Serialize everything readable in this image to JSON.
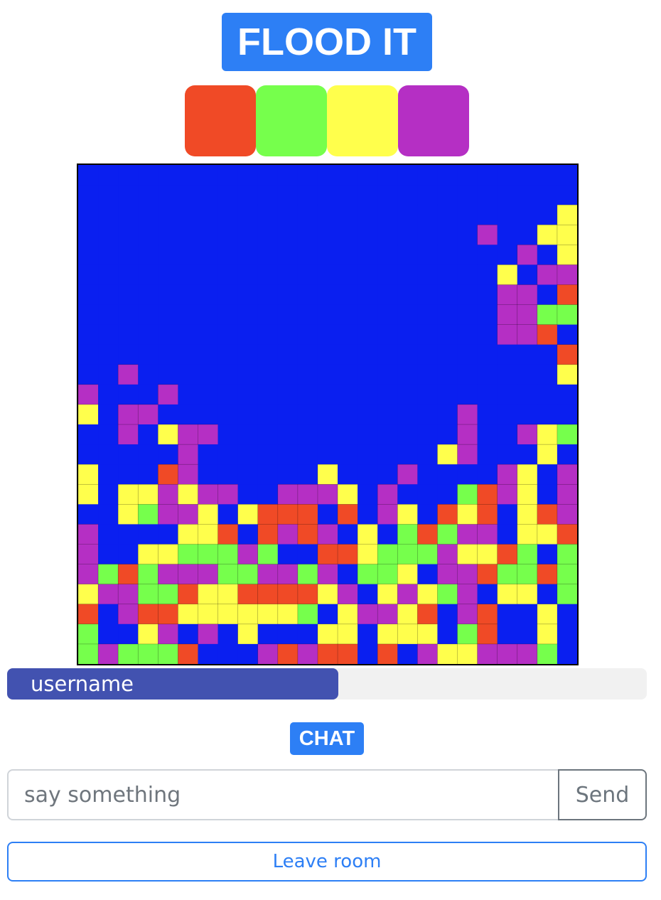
{
  "title": "FLOOD IT",
  "palette": [
    {
      "name": "red",
      "color": "#f04a26"
    },
    {
      "name": "green",
      "color": "#76ff4c"
    },
    {
      "name": "yellow",
      "color": "#ffff4c"
    },
    {
      "name": "purple",
      "color": "#b52fc4"
    }
  ],
  "board": {
    "size": 25,
    "cell_colors": {
      "B": "#0a1ff0",
      "R": "#f04a26",
      "G": "#76ff4c",
      "Y": "#ffff4c",
      "P": "#b52fc4"
    },
    "rows": [
      "BBBBBBBBBBBBBBBBBBBBBBBBB",
      "BBBBBBBBBBBBBBBBBBBBBBBBB",
      "BBBBBBBBBBBBBBBBBBBBBBBBY",
      "BBBBBBBBBBBBBBBBBBBBPBBYY",
      "BBBBBBBBBBBBBBBBBBBBBBPBYBBR",
      "BBBBBBBBBBBBBBBBBBBBBYBPPRB",
      "BBBBBBBBBBBBBBBBBBBBBPPBRBB",
      "BBBBBBBBBBBBBBBBBBBBBPPGGPRB",
      "BBBBBBBBBBBBBBBBBBBBBPPRBGBR",
      "BBBBBBBBBBBBBBBBBBBBBBBBRRGR",
      "BBPBBBBBBBBBBBBBBBBBBBBBYGPR",
      "PBBBPBBBBBBBBBBBBBBBBBBBBBBY",
      "YBPPBBBBBBBBBBBBBBBPBBBBBRPG",
      "BBPBYPPBBBBBBBBBBBBPBBPYGYB",
      "BBBBBPBBBBBBBBBBBBYPBBBYBYG",
      "YBBBRPBBBBBBYBBBPBBBBPYBPYG",
      "YBYYPYPPBBPPPYBPBBBGRPYBPPB",
      "BBYGPPYBYRRRBRBPYBRYRBYRP",
      "PBBBBYYRBRPRPBYBGRGPPBYYR",
      "PBBYYGGGPGBBRRYGGGPYYRGBG",
      "PGRGPPPGGPPGPBGGYBPPRGGRG",
      "YPPGGRYYRRRRYPBYPYGPBYYBG",
      "RBPRRYYYYYYGBYPPYRBPRBBY",
      "GBBYPBPBYBBBYYBYYYBGRBBYBR",
      "GPGGGRBBBPRPRRBRBPYYPPPGB"
    ]
  },
  "progress": {
    "label": "username",
    "fraction": 0.518
  },
  "chat": {
    "title": "CHAT",
    "placeholder": "say something",
    "send_label": "Send"
  },
  "leave_label": "Leave room"
}
